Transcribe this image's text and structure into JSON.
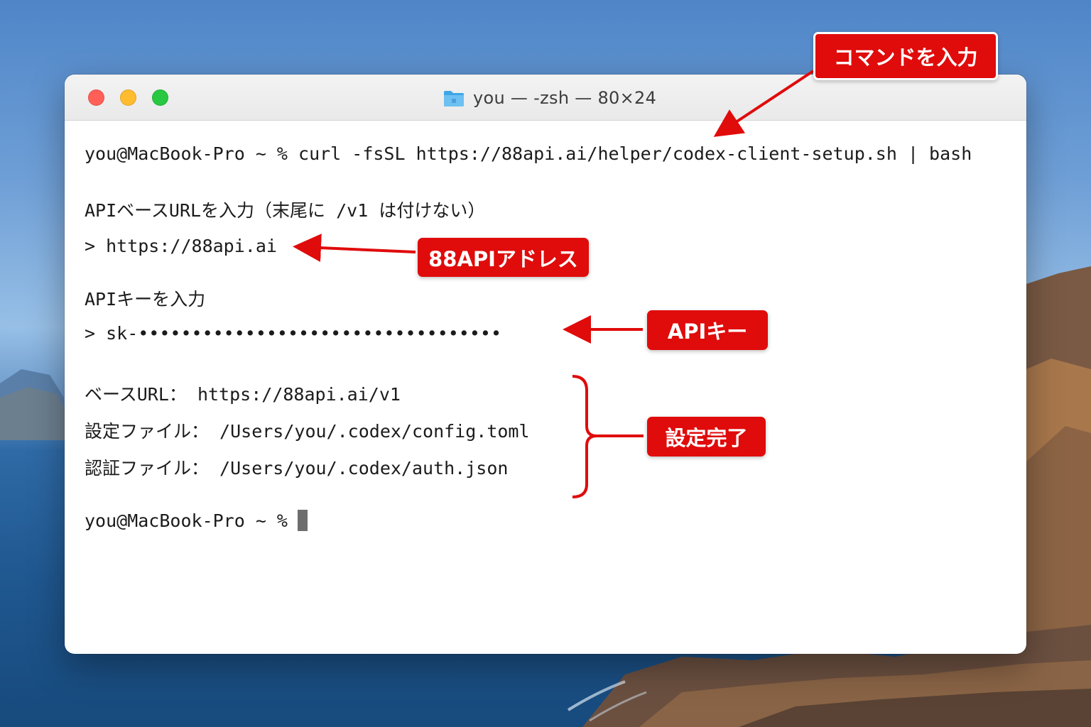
{
  "window": {
    "title": "you — -zsh — 80×24"
  },
  "terminal": {
    "lines": [
      "you@MacBook-Pro ~ % curl -fsSL https://88api.ai/helper/codex-client-setup.sh | bash",
      "APIベースURLを入力（末尾に /v1 は付けない）",
      "> https://88api.ai",
      "APIキーを入力",
      "> sk-••••••••••••••••••••••••••••••••••",
      "ベースURL： https://88api.ai/v1",
      "設定ファイル： /Users/you/.codex/config.toml",
      "認証ファイル： /Users/you/.codex/auth.json",
      "you@MacBook-Pro ~ %"
    ]
  },
  "callouts": {
    "command": "コマンドを入力",
    "address": "88APIアドレス",
    "api_key": "APIキー",
    "setup_done": "設定完了"
  },
  "colors": {
    "callout": "#e00b0b",
    "close": "#ff5f57",
    "minimize": "#febc2e",
    "zoom": "#28c840"
  },
  "icons": [
    "folder-icon",
    "cursor-block"
  ]
}
